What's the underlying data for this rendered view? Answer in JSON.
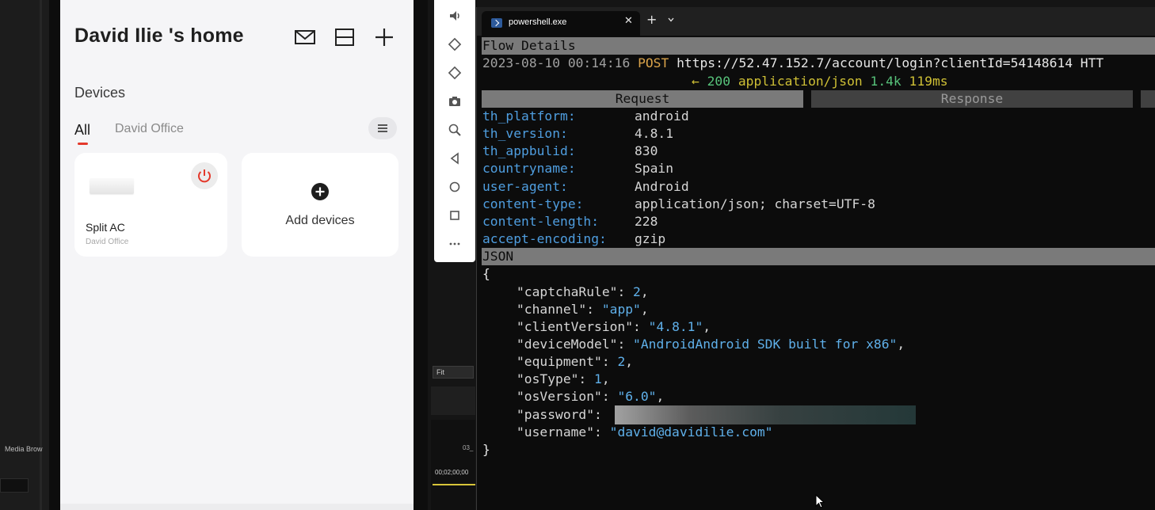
{
  "editor": {
    "media_browser_label": "Media Brow",
    "fit_label": "Fit",
    "timeline_clip_label": "03_",
    "timeline_time": "00;02;00;00"
  },
  "app": {
    "home_title": "David Ilie 's home",
    "icons": [
      "mail-icon",
      "scan-icon",
      "add-icon"
    ],
    "section_title": "Devices",
    "tabs": [
      {
        "label": "All",
        "active": true
      },
      {
        "label": "David Office",
        "active": false
      }
    ],
    "device_card": {
      "name": "Split AC",
      "room": "David Office",
      "power_color": "#e4392b"
    },
    "add_card": {
      "label": "Add devices"
    }
  },
  "emulator": {
    "tools": [
      "volume-icon",
      "rotate-left-icon",
      "rotate-right-icon",
      "camera-icon",
      "zoom-icon",
      "back-icon",
      "home-icon",
      "overview-icon",
      "more-icon"
    ]
  },
  "terminal": {
    "tab_title": "powershell.exe",
    "close_glyph": "✕",
    "new_tab_glyph": "+",
    "flow_title": "Flow Details",
    "request_line": {
      "timestamp": "2023-08-10 00:14:16",
      "method": "POST",
      "url": "https://52.47.152.7/account/login?clientId=54148614 HTT"
    },
    "response_line": {
      "arrow": "←",
      "status": "200",
      "content_type": "application/json",
      "size": "1.4k",
      "time": "119ms"
    },
    "subtabs": {
      "request": "Request",
      "response": "Response"
    },
    "headers": [
      {
        "key": "th_platform:",
        "value": "android"
      },
      {
        "key": "th_version:",
        "value": "4.8.1"
      },
      {
        "key": "th_appbulid:",
        "value": "830"
      },
      {
        "key": "countryname:",
        "value": "Spain"
      },
      {
        "key": "user-agent:",
        "value": "Android"
      },
      {
        "key": "content-type:",
        "value": "application/json; charset=UTF-8"
      },
      {
        "key": "content-length:",
        "value": "228"
      },
      {
        "key": "accept-encoding:",
        "value": "gzip"
      }
    ],
    "json_title": "JSON",
    "json_open": "{",
    "json_close": "}",
    "json_body": [
      {
        "key": "\"captchaRule\"",
        "value": "2",
        "type": "num",
        "comma": ","
      },
      {
        "key": "\"channel\"",
        "value": "\"app\"",
        "type": "str",
        "comma": ","
      },
      {
        "key": "\"clientVersion\"",
        "value": "\"4.8.1\"",
        "type": "str",
        "comma": ","
      },
      {
        "key": "\"deviceModel\"",
        "value": "\"AndroidAndroid SDK built for x86\"",
        "type": "str",
        "comma": ","
      },
      {
        "key": "\"equipment\"",
        "value": "2",
        "type": "num",
        "comma": ","
      },
      {
        "key": "\"osType\"",
        "value": "1",
        "type": "num",
        "comma": ","
      },
      {
        "key": "\"osVersion\"",
        "value": "\"6.0\"",
        "type": "str",
        "comma": ","
      },
      {
        "key": "\"password\"",
        "value": "",
        "type": "redacted",
        "comma": ""
      },
      {
        "key": "\"username\"",
        "value": "\"david@davidilie.com\"",
        "type": "str",
        "comma": ""
      }
    ],
    "colors": {
      "key_blue": "#4f9ee0",
      "value_blue": "#5fb0ea",
      "method_orange": "#d8a24a",
      "status_green": "#57c27a",
      "yellow": "#cfc035"
    }
  }
}
